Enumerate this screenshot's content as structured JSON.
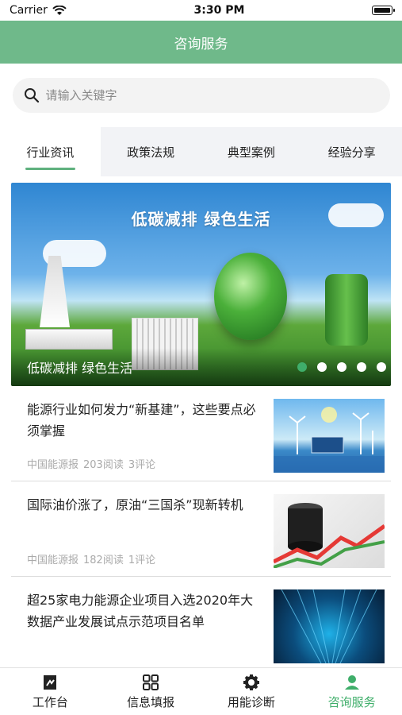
{
  "status_bar": {
    "carrier": "Carrier",
    "time": "3:30 PM"
  },
  "header": {
    "title": "咨询服务"
  },
  "search": {
    "placeholder": "请输入关键字"
  },
  "tabs": [
    {
      "label": "行业资讯",
      "active": true
    },
    {
      "label": "政策法规",
      "active": false
    },
    {
      "label": "典型案例",
      "active": false
    },
    {
      "label": "经验分享",
      "active": false
    }
  ],
  "banner": {
    "headline": "低碳减排 绿色生活",
    "caption": "低碳减排 绿色生活",
    "slide_count": 5,
    "active_slide": 1
  },
  "news": [
    {
      "title": "能源行业如何发力“新基建”，这些要点必须掌握",
      "source": "中国能源报",
      "reads": "203阅读",
      "comments": "3评论"
    },
    {
      "title": "国际油价涨了，原油“三国杀”现新转机",
      "source": "中国能源报",
      "reads": "182阅读",
      "comments": "1评论"
    },
    {
      "title": "超25家电力能源企业项目入选2020年大数据产业发展试点示范项目名单",
      "source": "",
      "reads": "",
      "comments": ""
    }
  ],
  "tabbar": [
    {
      "label": "工作台",
      "icon": "workbench-icon",
      "active": false
    },
    {
      "label": "信息填报",
      "icon": "grid-icon",
      "active": false
    },
    {
      "label": "用能诊断",
      "icon": "gear-icon",
      "active": false
    },
    {
      "label": "咨询服务",
      "icon": "person-icon",
      "active": true
    }
  ],
  "colors": {
    "accent": "#6fb98a",
    "active_tab_text": "#3fae6a"
  }
}
